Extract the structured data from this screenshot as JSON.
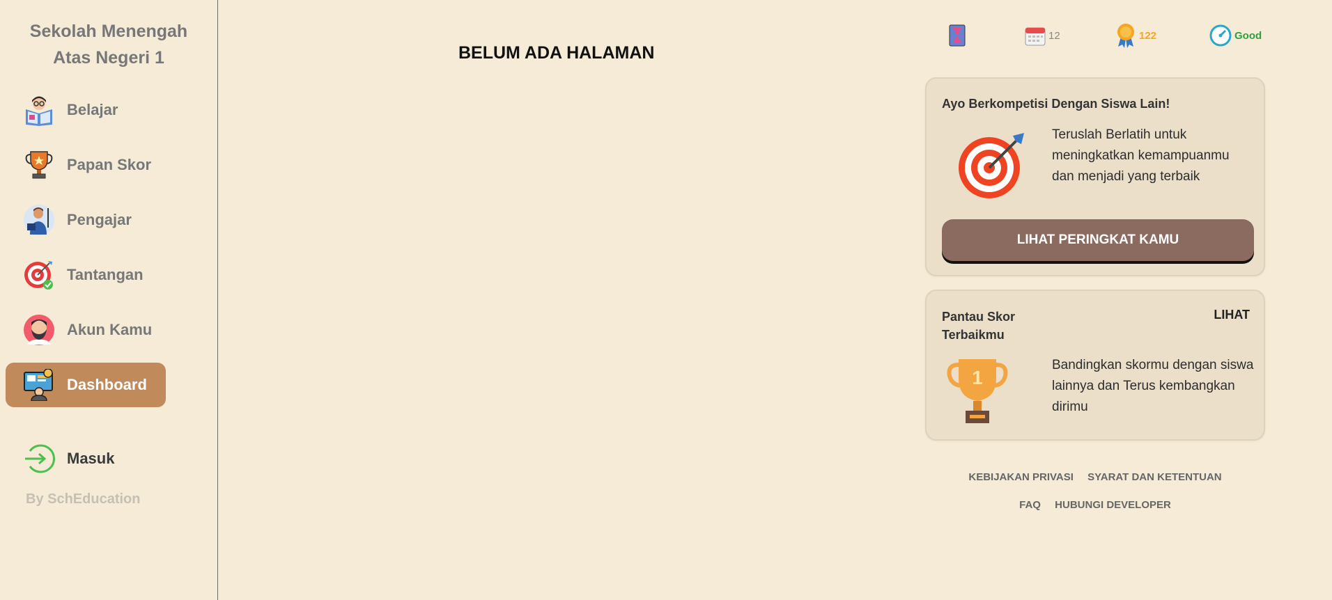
{
  "sidebar": {
    "school_line1": "Sekolah Menengah",
    "school_line2": "Atas Negeri 1",
    "items": [
      {
        "label": "Belajar",
        "icon": "reading-student-icon"
      },
      {
        "label": "Papan Skor",
        "icon": "trophy-icon"
      },
      {
        "label": "Pengajar",
        "icon": "teacher-icon"
      },
      {
        "label": "Tantangan",
        "icon": "target-check-icon"
      },
      {
        "label": "Akun Kamu",
        "icon": "bearded-avatar-icon"
      },
      {
        "label": "Dashboard",
        "icon": "dashboard-monitor-icon",
        "active": true
      }
    ],
    "login": {
      "label": "Masuk",
      "icon": "login-arrow-icon"
    },
    "byline": "By SchEducation"
  },
  "main": {
    "title": "BELUM ADA HALAMAN"
  },
  "stats": {
    "streak_icon": "hourglass-book-icon",
    "days": "12",
    "points": "122",
    "status": "Good",
    "colors": {
      "points": "#f5a623",
      "status": "#2e9e3e"
    }
  },
  "competition_card": {
    "title": "Ayo Berkompetisi Dengan Siswa Lain!",
    "body": "Teruslah Berlatih untuk meningkatkan kemampuanmu dan menjadi yang terbaik",
    "button": "LIHAT PERINGKAT KAMU",
    "icon": "bullseye-dart-icon"
  },
  "score_card": {
    "title": "Pantau Skor Terbaikmu",
    "link": "LIHAT",
    "body": "Bandingkan skormu dengan siswa lainnya dan Terus kembangkan dirimu",
    "icon": "trophy-first-place-icon",
    "trophy_number": "1"
  },
  "footer": {
    "privacy": "KEBIJAKAN PRIVASI",
    "terms": "SYARAT DAN KETENTUAN",
    "faq": "FAQ",
    "contact": "HUBUNGI DEVELOPER"
  },
  "theme": {
    "background": "#f5ebd7",
    "active_nav": "#c08a5a",
    "cta_button": "#8b6a5f"
  }
}
